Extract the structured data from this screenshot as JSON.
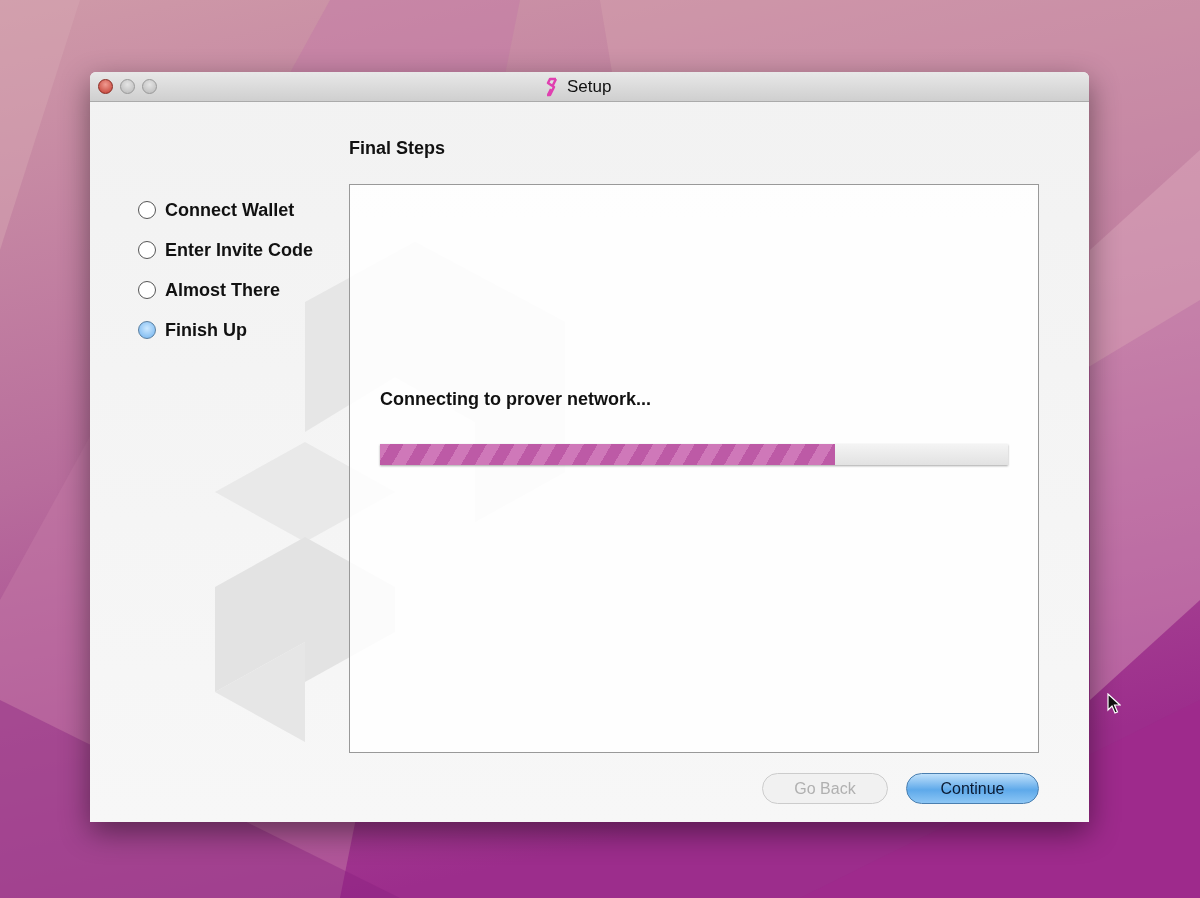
{
  "window": {
    "title": "Setup"
  },
  "steps": [
    {
      "label": "Connect Wallet",
      "selected": false
    },
    {
      "label": "Enter Invite Code",
      "selected": false
    },
    {
      "label": "Almost There",
      "selected": false
    },
    {
      "label": "Finish Up",
      "selected": true
    }
  ],
  "heading": "Final Steps",
  "status_text": "Connecting to prover network...",
  "progress": {
    "level": 0.725
  },
  "buttons": [
    {
      "label": "Go Back",
      "disabled": true,
      "default": false
    },
    {
      "label": "Continue",
      "disabled": false,
      "default": true
    }
  ]
}
